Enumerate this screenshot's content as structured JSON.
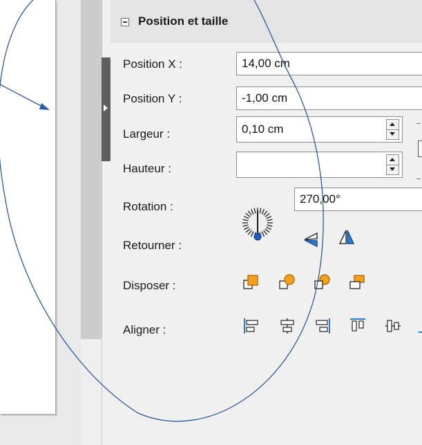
{
  "panel": {
    "title": "Position et taille",
    "labels": {
      "position_x": "Position X :",
      "position_y": "Position Y :",
      "width": "Largeur :",
      "height": "Hauteur :",
      "rotation": "Rotation :",
      "flip": "Retourner :",
      "arrange": "Disposer :",
      "align": "Aligner :"
    },
    "values": {
      "position_x": "14,00 cm",
      "position_y": "-1,00 cm",
      "width": "0,10 cm",
      "height": "",
      "rotation": "270,00°"
    }
  },
  "icons": {
    "collapse": "minus-box-icon",
    "splitter": "expand-arrow-icon",
    "rotation": "rotation-dial-icon",
    "flip": [
      "flip-vertical-icon",
      "flip-horizontal-icon"
    ],
    "arrange": [
      "bring-to-front-icon",
      "forward-one-icon",
      "back-one-icon",
      "send-to-back-icon"
    ],
    "align": [
      "align-left-icon",
      "align-center-icon",
      "align-right-icon",
      "align-top-icon",
      "align-middle-icon"
    ]
  },
  "colors": {
    "arrange_accent": "#f4a21d",
    "align_accent": "#2a7ad6",
    "flip_accent": "#2a7ad6",
    "annotation": "#2a5aa0"
  }
}
